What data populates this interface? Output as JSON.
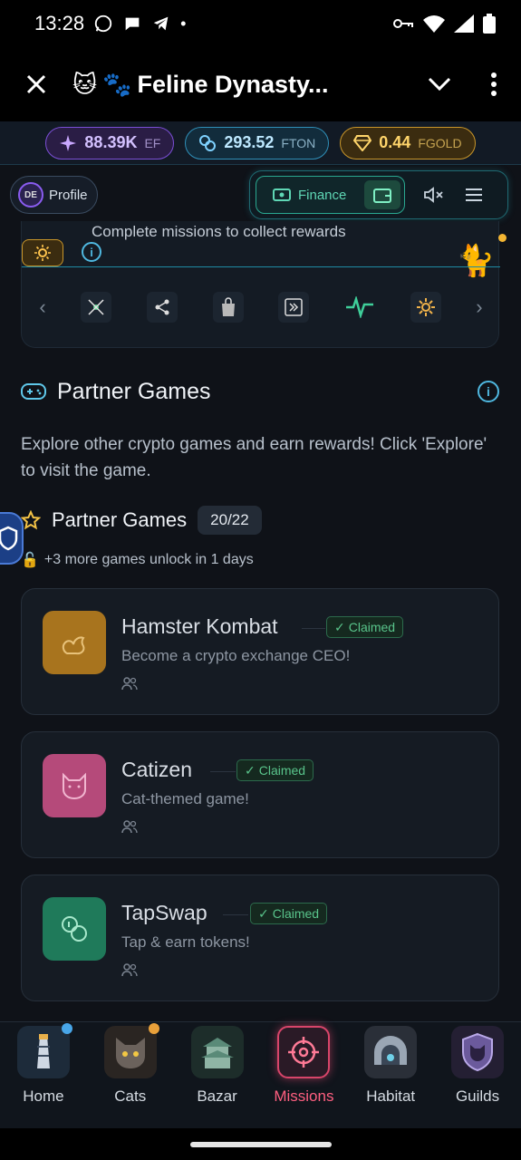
{
  "status": {
    "time": "13:28"
  },
  "titlebar": {
    "title": "Feline Dynasty...",
    "emoji_cat": "🐱",
    "emoji_paw": "🐾"
  },
  "currencies": [
    {
      "value": "88.39K",
      "unit": "EF"
    },
    {
      "value": "293.52",
      "unit": "FTON"
    },
    {
      "value": "0.44",
      "unit": "FGOLD"
    }
  ],
  "toolbar": {
    "profile_initials": "DE",
    "profile_label": "Profile",
    "finance_label": "Finance"
  },
  "missions": {
    "hint": "Complete missions to collect rewards"
  },
  "partner": {
    "section_title": "Partner Games",
    "description": "Explore other crypto games and earn rewards! Click 'Explore' to visit the game.",
    "sub_title": "Partner Games",
    "count": "20/22",
    "unlock_text": "+3 more games unlock in 1 days",
    "games": [
      {
        "name": "Hamster Kombat",
        "status": "Claimed",
        "description": "Become a crypto exchange CEO!",
        "color": "#a8741e"
      },
      {
        "name": "Catizen",
        "status": "Claimed",
        "description": "Cat-themed game!",
        "color": "#b54a7a"
      },
      {
        "name": "TapSwap",
        "status": "Claimed",
        "description": "Tap & earn tokens!",
        "color": "#1f7a5a"
      }
    ]
  },
  "nav": [
    {
      "label": "Home"
    },
    {
      "label": "Cats"
    },
    {
      "label": "Bazar"
    },
    {
      "label": "Missions"
    },
    {
      "label": "Habitat"
    },
    {
      "label": "Guilds"
    }
  ]
}
